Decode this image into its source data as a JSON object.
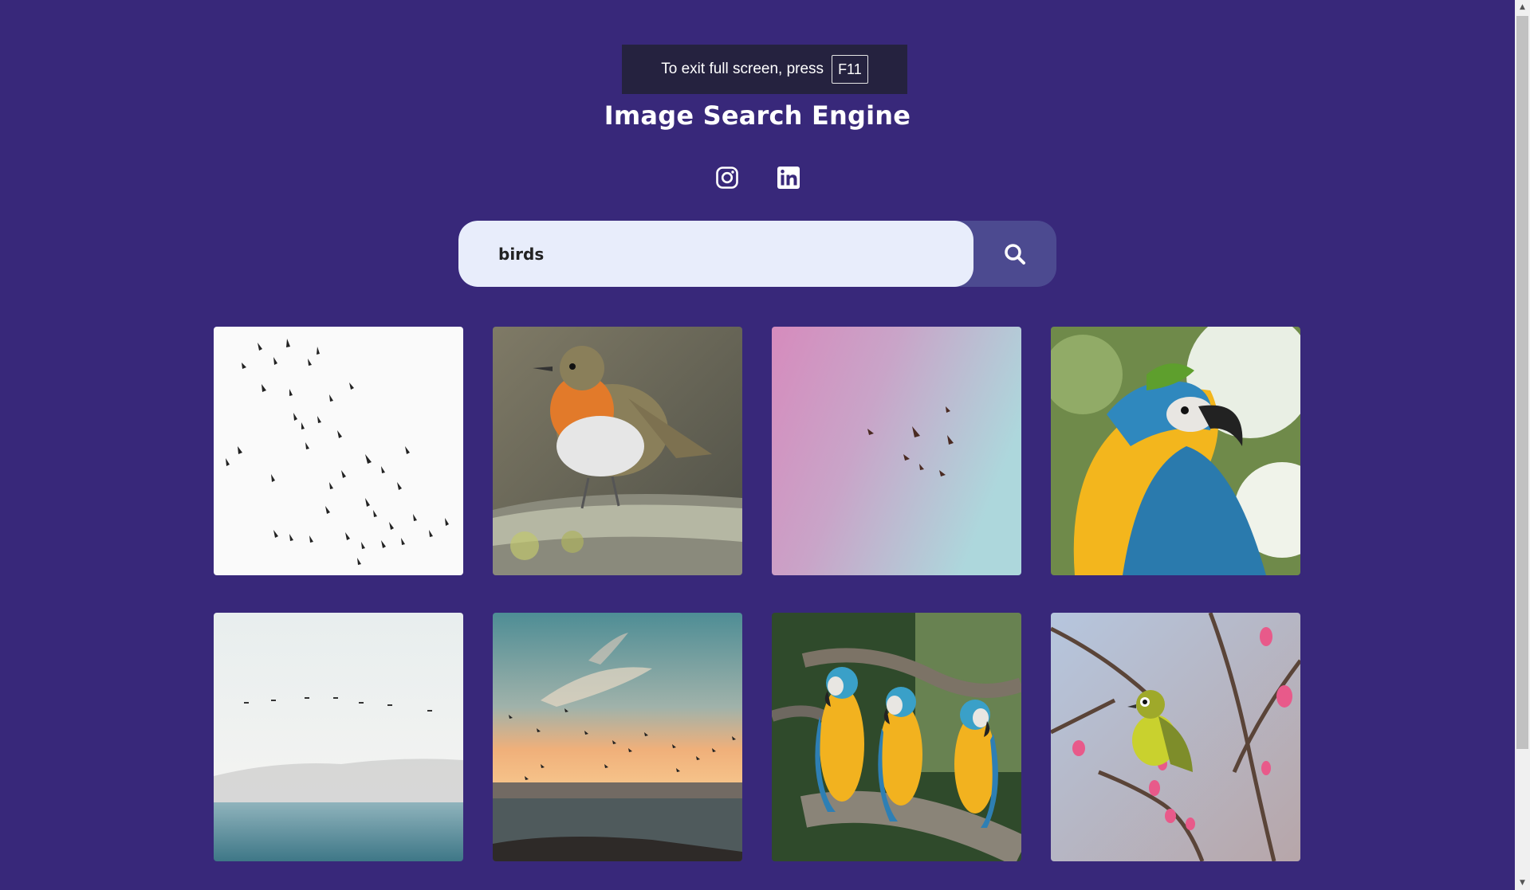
{
  "fullscreen_notice": {
    "text": "To exit full screen, press",
    "key": "F11"
  },
  "header": {
    "title": "Image Search Engine"
  },
  "socials": [
    {
      "name": "instagram",
      "icon": "instagram-icon"
    },
    {
      "name": "linkedin",
      "icon": "linkedin-icon"
    }
  ],
  "search": {
    "value": "birds",
    "button_icon": "search-icon"
  },
  "results": [
    {
      "subject": "flock of birds on white sky"
    },
    {
      "subject": "robin on a branch"
    },
    {
      "subject": "birds flying in pink-blue sky"
    },
    {
      "subject": "blue and yellow macaw"
    },
    {
      "subject": "birds over the sea"
    },
    {
      "subject": "birds at sunset over ocean"
    },
    {
      "subject": "three macaws on a branch"
    },
    {
      "subject": "yellow bird on blossom branch"
    }
  ],
  "colors": {
    "background": "#38287a",
    "search_field": "#e8edfb",
    "search_button": "#4c4a90"
  }
}
